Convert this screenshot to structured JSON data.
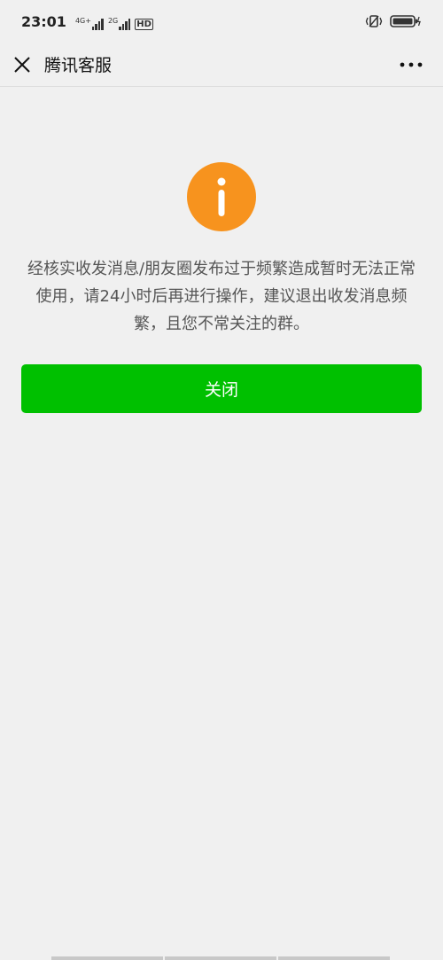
{
  "status_bar": {
    "time": "23:01",
    "network_1": "4G+",
    "network_2": "2G",
    "hd_label": "HD"
  },
  "header": {
    "title": "腾讯客服"
  },
  "main": {
    "message": "经核实收发消息/朋友圈发布过于频繁造成暂时无法正常使用，请24小时后再进行操作，建议退出收发消息频繁，且您不常关注的群。",
    "close_label": "关闭"
  },
  "colors": {
    "info_icon": "#f7931e",
    "primary_button": "#00c000",
    "background": "#f0f0f0"
  },
  "icons": {
    "close": "close-icon",
    "more": "more-icon",
    "info": "info-icon"
  }
}
